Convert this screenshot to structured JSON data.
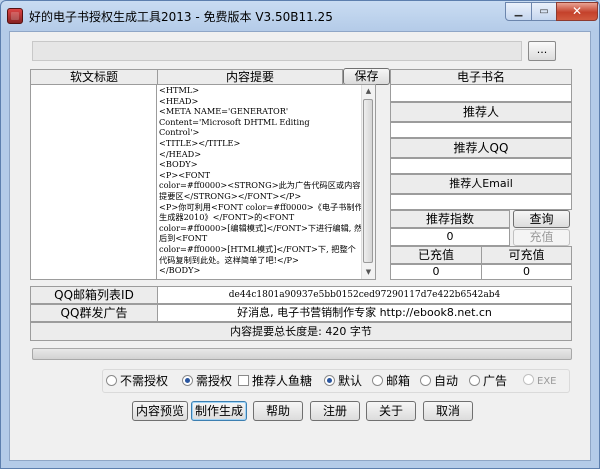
{
  "window": {
    "title": "好的电子书授权生成工具2013 - 免费版本 V3.50B11.25",
    "minimize": "▁",
    "maximize": "▭",
    "close": "✕"
  },
  "top": {
    "browse_label": "...",
    "path_value": ""
  },
  "table": {
    "col_soft_title": "软文标题",
    "col_content_summary": "内容提要",
    "save_button": "保存",
    "col_ebook_name": "电子书名",
    "content_html": "<HTML>\n<HEAD>\n<META NAME='GENERATOR'\nContent='Microsoft DHTML Editing\nControl'>\n<TITLE></TITLE>\n</HEAD>\n<BODY>\n<P><FONT\ncolor=#ff0000><STRONG>此为广告代码区或内容提要区</STRONG></FONT></P>\n<P>你可利用<FONT color=#ff0000>《电子书制作生成器2010》</FONT>的<FONT\ncolor=#ff0000>[编辑模式]</FONT>下进行编辑, 然后到<FONT\ncolor=#ff0000>[HTML模式]</FONT>下, 把整个代码复制到此处。这样简单了吧!</P>\n</BODY>"
  },
  "right_panel": {
    "recommender": "推荐人",
    "recommender_qq": "推荐人QQ",
    "recommender_email": "推荐人Email",
    "recommend_index": "推荐指数",
    "recommend_index_value": "0",
    "query_button": "查询",
    "recharge_button": "充值",
    "recharged": "已充值",
    "recharged_value": "0",
    "available": "可充值",
    "available_value": "0"
  },
  "info_rows": {
    "qq_mailbox_label": "QQ邮箱列表ID",
    "qq_mailbox_value": "de44c1801a90937e5bb0152ced97290117d7e422b6542ab4",
    "qq_group_ad_label": "QQ群发广告",
    "qq_group_ad_value": "好消息, 电子书营销制作专家  http://ebook8.net.cn",
    "summary_length": "内容提要总长度是:  420  字节"
  },
  "options": {
    "no_auth": "不需授权",
    "need_auth": "需授权",
    "recommender_fish": "推荐人鱼糖",
    "default": "默认",
    "mailbox": "邮箱",
    "auto": "自动",
    "ad": "广告",
    "exe": "EXE"
  },
  "buttons": {
    "preview": "内容预览",
    "generate": "制作生成",
    "help": "帮助",
    "register": "注册",
    "about": "关于",
    "cancel": "取消"
  }
}
